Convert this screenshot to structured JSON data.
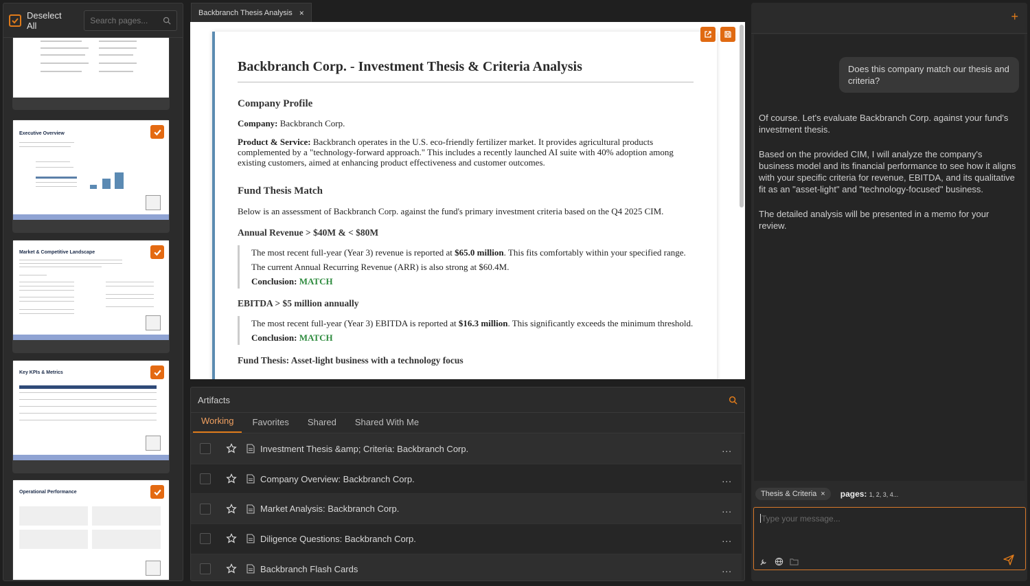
{
  "left_panel": {
    "deselect_label": "Deselect All",
    "search_placeholder": "Search pages...",
    "thumbnails": [
      {
        "title": ""
      },
      {
        "title": "Executive Overview"
      },
      {
        "title": "Market & Competitive Landscape"
      },
      {
        "title": "Key KPIs & Metrics"
      },
      {
        "title": "Operational Performance"
      }
    ]
  },
  "document": {
    "tab_label": "Backbranch Thesis Analysis",
    "title": "Backbranch Corp. - Investment Thesis & Criteria Analysis",
    "company_profile_heading": "Company Profile",
    "company_label": "Company:",
    "company_value": "Backbranch Corp.",
    "product_label": "Product & Service:",
    "product_text": "Backbranch operates in the U.S. eco-friendly fertilizer market. It provides agricultural products complemented by a \"technology-forward approach.\" This includes a recently launched AI suite with 40% adoption among existing customers, aimed at enhancing product effectiveness and customer outcomes.",
    "fund_thesis_heading": "Fund Thesis Match",
    "fund_thesis_intro": "Below is an assessment of Backbranch Corp. against the fund's primary investment criteria based on the Q4 2025 CIM.",
    "criteria": [
      {
        "heading": "Annual Revenue > $40M & < $80M",
        "text_before": "The most recent full-year (Year 3) revenue is reported at ",
        "bold": "$65.0 million",
        "text_after": ". This fits comfortably within your specified range. The current Annual Recurring Revenue (ARR) is also strong at $60.4M.",
        "conclusion_label": "Conclusion:",
        "conclusion_value": "MATCH"
      },
      {
        "heading": "EBITDA > $5 million annually",
        "text_before": "The most recent full-year (Year 3) EBITDA is reported at ",
        "bold": "$16.3 million",
        "text_after": ". This significantly exceeds the minimum threshold.",
        "conclusion_label": "Conclusion:",
        "conclusion_value": "MATCH"
      }
    ],
    "cut_off_line": "Fund Thesis: Asset-light business with a technology focus"
  },
  "artifacts": {
    "title": "Artifacts",
    "tabs": [
      "Working",
      "Favorites",
      "Shared",
      "Shared With Me"
    ],
    "active_tab": "Working",
    "items": [
      "Investment Thesis &amp; Criteria: Backbranch Corp.",
      "Company Overview: Backbranch Corp.",
      "Market Analysis: Backbranch Corp.",
      "Diligence Questions: Backbranch Corp.",
      "Backbranch Flash Cards"
    ],
    "more_label": "..."
  },
  "chat": {
    "new_label": "+",
    "user_message": "Does this company match our thesis and criteria?",
    "assistant_paragraphs": [
      "Of course. Let's evaluate Backbranch Corp. against your fund's investment thesis.",
      "Based on the provided CIM, I will analyze the company's business model and its financial performance to see how it aligns with your specific criteria for revenue, EBITDA, and its qualitative fit as an \"asset-light\" and \"technology-focused\" business.",
      "The detailed analysis will be presented in a memo for your review."
    ],
    "context_chip": "Thesis & Criteria",
    "pages_label": "pages:",
    "pages_value": "1, 2, 3, 4...",
    "input_placeholder": "Type your message..."
  },
  "colors": {
    "accent": "#e07b1a",
    "match_green": "#2e8b3e",
    "doc_border": "#5b8bb1"
  }
}
